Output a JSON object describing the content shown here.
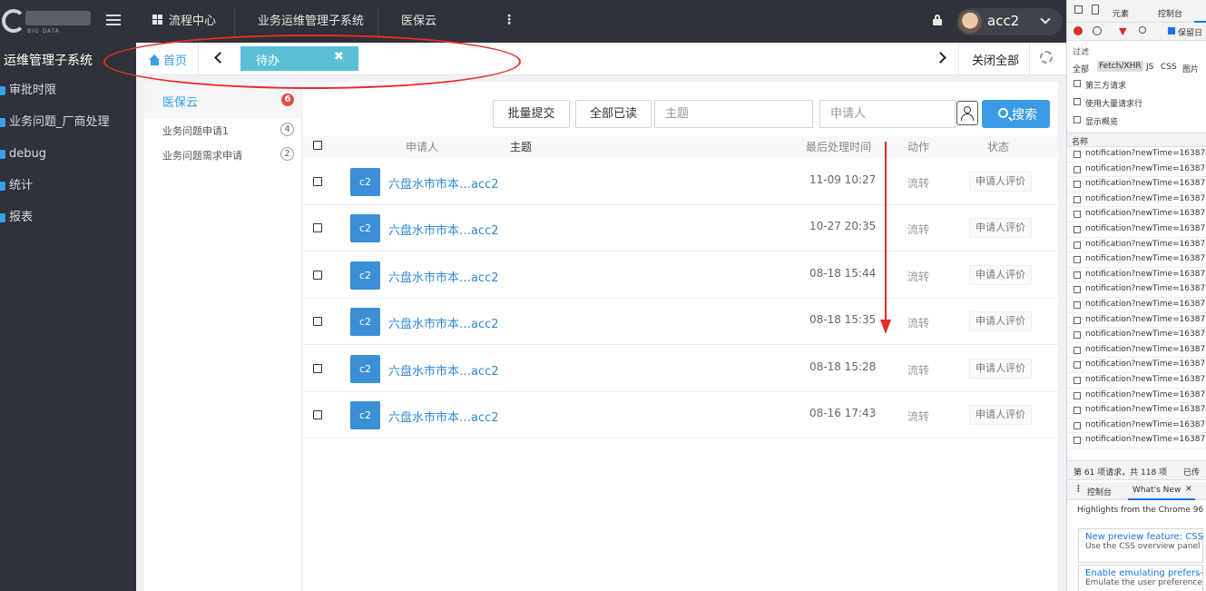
{
  "sidebar": {
    "logo_sub": "BIG DATA",
    "system_title": "运维管理子系统",
    "items": [
      {
        "label": "审批时限"
      },
      {
        "label": "业务问题_厂商处理"
      },
      {
        "label": "debug"
      },
      {
        "label": "统计"
      },
      {
        "label": "报表"
      }
    ]
  },
  "topbar": {
    "nav": [
      "流程中心",
      "业务运维管理子系统",
      "医保云"
    ],
    "more": "⋮",
    "username": "acc2"
  },
  "tabs": {
    "home": "首页",
    "active": "待办",
    "close_glyph": "✖",
    "close_all": "关闭全部"
  },
  "left_panel": {
    "group": {
      "label": "医保云",
      "count": "6"
    },
    "items": [
      {
        "label": "业务问题申请1",
        "count": "4"
      },
      {
        "label": "业务问题需求申请",
        "count": "2"
      }
    ]
  },
  "toolbar": {
    "batch_submit": "批量提交",
    "mark_all_read": "全部已读",
    "subject_placeholder": "主题",
    "applicant_placeholder": "申请人",
    "search": "搜索"
  },
  "table": {
    "headers": {
      "applicant": "申请人",
      "subject": "主题",
      "last_time": "最后处理时间",
      "action": "动作",
      "status": "状态"
    },
    "rows": [
      {
        "avatar": "c2",
        "subject": "六盘水市市本…acc2",
        "time": "11-09 10:27",
        "action": "流转",
        "status": "申请人评价"
      },
      {
        "avatar": "c2",
        "subject": "六盘水市市本…acc2",
        "time": "10-27 20:35",
        "action": "流转",
        "status": "申请人评价"
      },
      {
        "avatar": "c2",
        "subject": "六盘水市市本…acc2",
        "time": "08-18 15:44",
        "action": "流转",
        "status": "申请人评价"
      },
      {
        "avatar": "c2",
        "subject": "六盘水市市本…acc2",
        "time": "08-18 15:35",
        "action": "流转",
        "status": "申请人评价"
      },
      {
        "avatar": "c2",
        "subject": "六盘水市市本…acc2",
        "time": "08-18 15:28",
        "action": "流转",
        "status": "申请人评价"
      },
      {
        "avatar": "c2",
        "subject": "六盘水市市本…acc2",
        "time": "08-16 17:43",
        "action": "流转",
        "status": "申请人评价"
      }
    ]
  },
  "devtools": {
    "tabs": [
      "元素",
      "控制台"
    ],
    "preserve_log": "保留日",
    "filter": "过滤",
    "types": [
      "全部",
      "Fetch/XHR",
      "JS",
      "CSS",
      "图片"
    ],
    "third_party": "第三方请求",
    "large_rows": "使用大量请求行",
    "overview": "显示概览",
    "name_col": "名称",
    "request_name": "notification?newTime=163877",
    "request_count": 20,
    "status_text": "第 61 项请求，共 118 项",
    "status_text2": "已传",
    "drawer_tabs": [
      "控制台",
      "What's New"
    ],
    "drawer_close": "✕",
    "highlights": "Highlights from the Chrome 96 u",
    "cards": [
      {
        "title": "New preview feature: CSS",
        "desc": "Use the CSS overview panel"
      },
      {
        "title": "Enable emulating prefers-",
        "desc": "Emulate the user preference"
      }
    ]
  },
  "colors": {
    "accent": "#3a9be5",
    "tab_active": "#5bc0d6",
    "sidebar": "#2f3238",
    "annotation": "#e52d27"
  }
}
